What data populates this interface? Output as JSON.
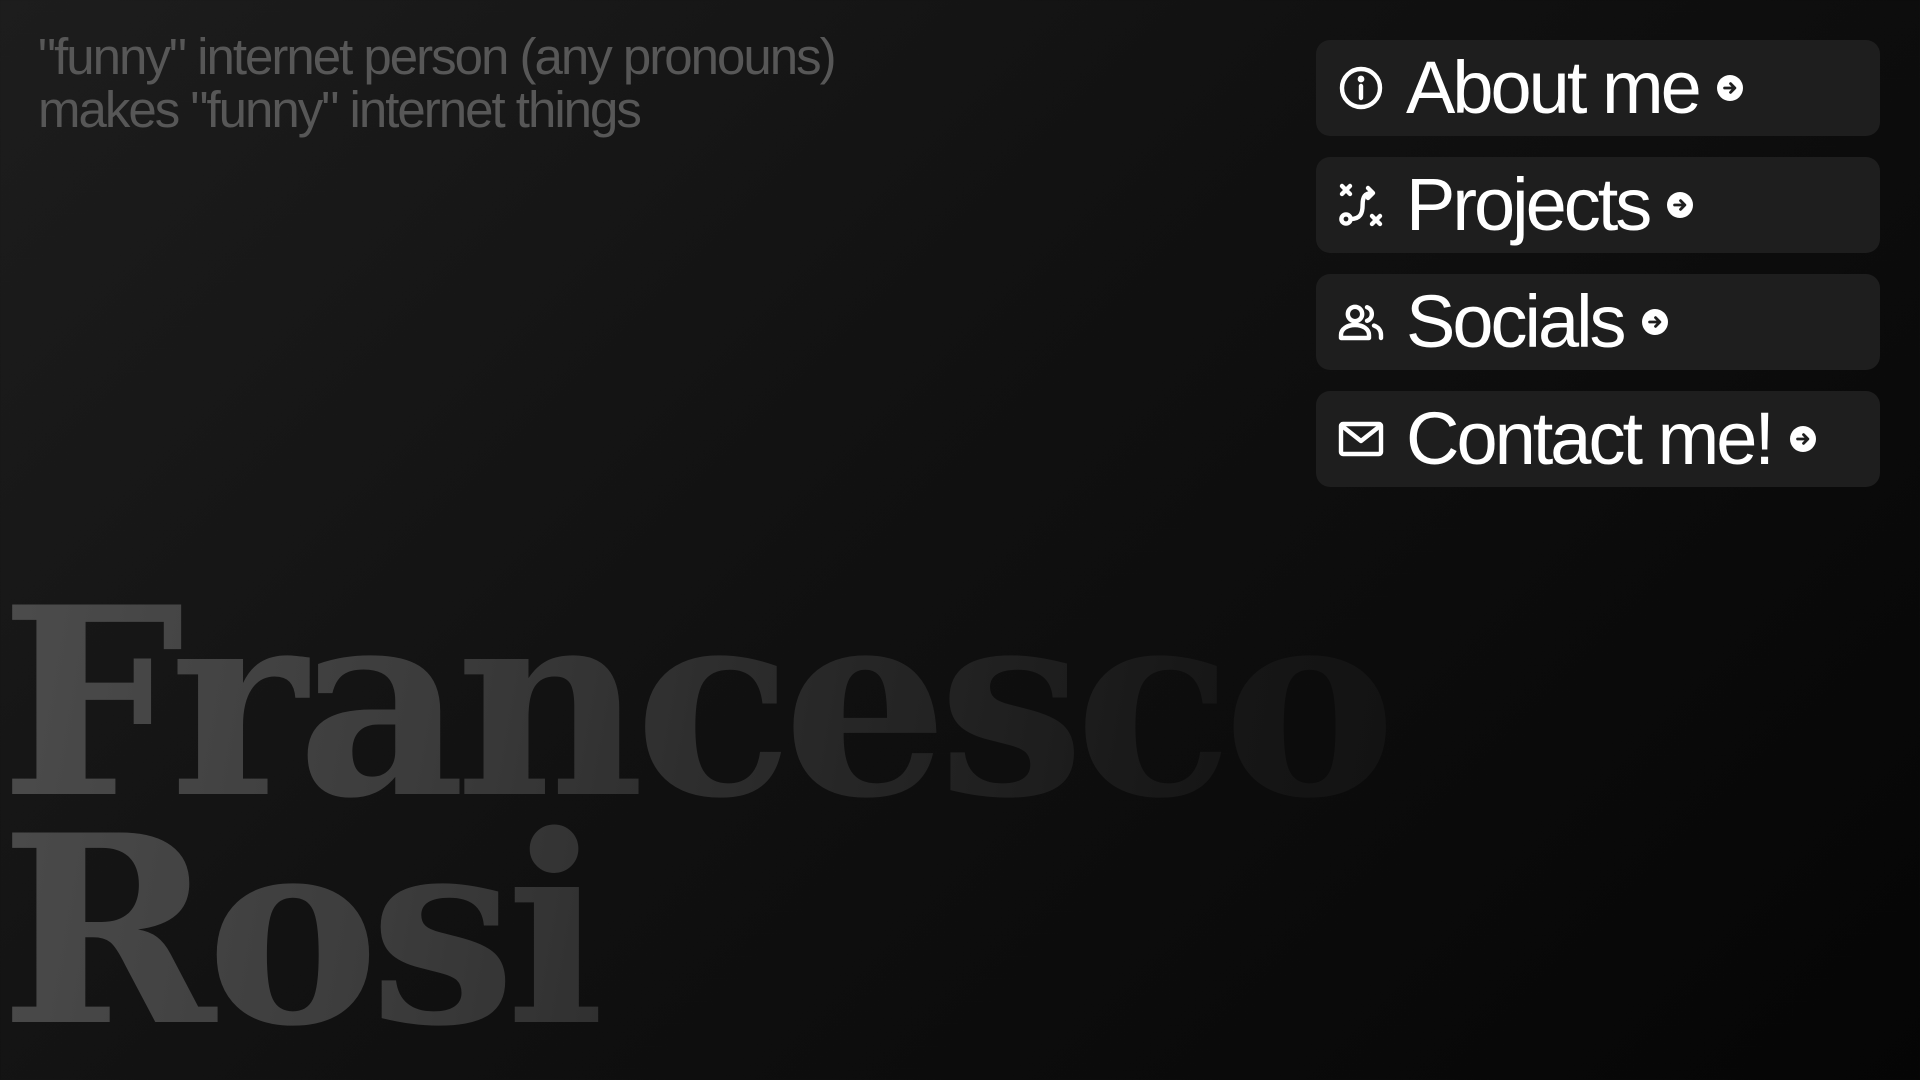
{
  "tagline": {
    "line1": "\"funny\" internet person (any pronouns)",
    "line2": "makes \"funny\" internet things"
  },
  "nav": {
    "items": [
      {
        "label": "About me",
        "icon": "info-icon"
      },
      {
        "label": "Projects",
        "icon": "route-icon"
      },
      {
        "label": "Socials",
        "icon": "users-icon"
      },
      {
        "label": "Contact me!",
        "icon": "mail-icon"
      }
    ]
  },
  "name": {
    "first": "Francesco",
    "last": "Rosi"
  },
  "colors": {
    "background": "#111111",
    "tagline": "#575757",
    "nav_bg": "#1e1e1e",
    "nav_text": "#ffffff"
  }
}
